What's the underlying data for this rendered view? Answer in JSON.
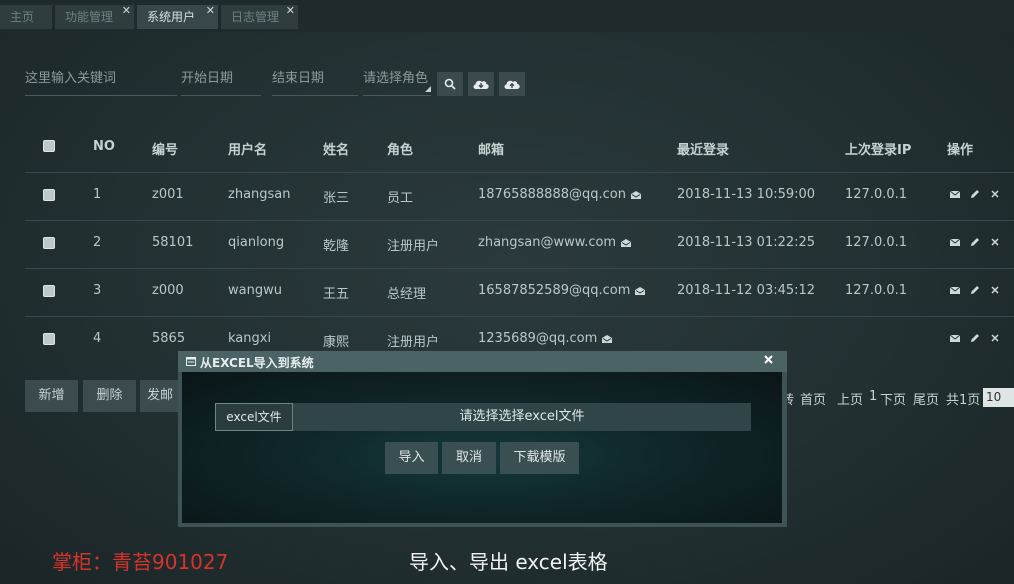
{
  "tabs": [
    {
      "label": "主页"
    },
    {
      "label": "功能管理"
    },
    {
      "label": "系统用户"
    },
    {
      "label": "日志管理"
    }
  ],
  "filters": {
    "keyword_placeholder": "这里输入关键词",
    "start_date_placeholder": "开始日期",
    "end_date_placeholder": "结束日期",
    "role_select": "请选择角色"
  },
  "icons": [
    "search-icon",
    "cloud-download-icon",
    "cloud-upload-icon"
  ],
  "table": {
    "headers": [
      "NO",
      "编号",
      "用户名",
      "姓名",
      "角色",
      "邮箱",
      "最近登录",
      "上次登录IP",
      "操作"
    ],
    "rows": [
      {
        "no": "1",
        "code": "z001",
        "username": "zhangsan",
        "name": "张三",
        "role": "员工",
        "email": "18765888888@qq.con",
        "last_login": "2018-11-13 10:59:00",
        "ip": "127.0.0.1"
      },
      {
        "no": "2",
        "code": "58101",
        "username": "qianlong",
        "name": "乾隆",
        "role": "注册用户",
        "email": "zhangsan@www.com",
        "last_login": "2018-11-13 01:22:25",
        "ip": "127.0.0.1"
      },
      {
        "no": "3",
        "code": "z000",
        "username": "wangwu",
        "name": "王五",
        "role": "总经理",
        "email": "16587852589@qq.com",
        "last_login": "2018-11-12 03:45:12",
        "ip": "127.0.0.1"
      },
      {
        "no": "4",
        "code": "5865",
        "username": "kangxi",
        "name": "康熙",
        "role": "注册用户",
        "email": "1235689@qq.com",
        "last_login": "",
        "ip": ""
      }
    ]
  },
  "actions": {
    "add": "新增",
    "delete": "删除",
    "send": "发邮"
  },
  "pager": {
    "jump": "转",
    "first": "首页",
    "prev": "上页",
    "current": "1",
    "next": "下页",
    "last": "尾页",
    "total": "共1页",
    "page_size": "10"
  },
  "modal": {
    "title": "从EXCEL导入到系统",
    "file_button": "excel文件",
    "file_placeholder": "请选择选择excel文件",
    "import": "导入",
    "cancel": "取消",
    "download_template": "下载模版"
  },
  "captions": {
    "left": "掌柜：青苔901027",
    "center": "导入、导出 excel表格"
  },
  "colors": {
    "caption_left": "#d8332b",
    "caption_center": "#f2f2f2"
  }
}
